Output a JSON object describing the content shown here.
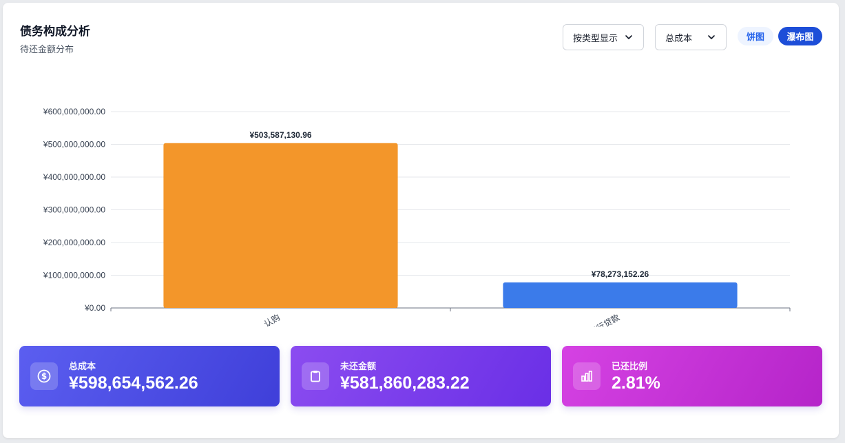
{
  "header": {
    "title": "债务构成分析",
    "subtitle": "待还金额分布"
  },
  "controls": {
    "group_by": {
      "selected": "按类型显示"
    },
    "metric": {
      "selected": "总成本"
    },
    "view_toggle": [
      {
        "label": "饼图",
        "active": false
      },
      {
        "label": "瀑布图",
        "active": true
      }
    ]
  },
  "chart_data": {
    "type": "bar",
    "categories": [
      "认购",
      "银行贷款"
    ],
    "values": [
      503587130.96,
      78273152.26
    ],
    "value_labels": [
      "¥503,587,130.96",
      "¥78,273,152.26"
    ],
    "colors": [
      "#f3962a",
      "#3b7bea"
    ],
    "ylim": [
      0,
      600000000
    ],
    "yticks": [
      "¥0.00",
      "¥100,000,000.00",
      "¥200,000,000.00",
      "¥300,000,000.00",
      "¥400,000,000.00",
      "¥500,000,000.00",
      "¥600,000,000.00"
    ],
    "grid": true,
    "xlabel": "",
    "ylabel": "",
    "title": ""
  },
  "stats": [
    {
      "label": "总成本",
      "value": "¥598,654,562.26",
      "icon": "dollar-circle-icon"
    },
    {
      "label": "未还金额",
      "value": "¥581,860,283.22",
      "icon": "clipboard-icon"
    },
    {
      "label": "已还比例",
      "value": "2.81%",
      "icon": "bar-chart-icon"
    }
  ]
}
